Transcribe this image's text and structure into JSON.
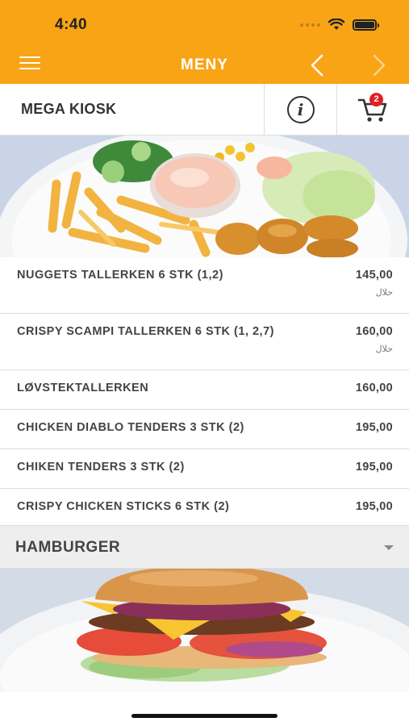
{
  "status_bar": {
    "time": "4:40"
  },
  "nav": {
    "title": "MENY",
    "menu_icon": "hamburger-menu-icon",
    "back_icon": "chevron-left-icon",
    "forward_icon": "chevron-right-icon"
  },
  "kiosk": {
    "name": "MEGA KIOSK",
    "info_icon": "info-icon",
    "cart_icon": "cart-icon",
    "cart_count": "2"
  },
  "menu_items": [
    {
      "name": "NUGGETS TALLERKEN 6 STK (1,2)",
      "price": "145,00",
      "tag": "حلال"
    },
    {
      "name": "CRISPY SCAMPI TALLERKEN 6 STK (1, 2,7)",
      "price": "160,00",
      "tag": "حلال"
    },
    {
      "name": "LØVSTEKTALLERKEN",
      "price": "160,00"
    },
    {
      "name": "CHICKEN DIABLO TENDERS 3 STK (2)",
      "price": "195,00"
    },
    {
      "name": "CHIKEN TENDERS 3 STK (2)",
      "price": "195,00"
    },
    {
      "name": "CRISPY CHICKEN STICKS 6 STK (2)",
      "price": "195,00"
    }
  ],
  "section": {
    "title": "HAMBURGER",
    "caret_icon": "caret-down-icon"
  },
  "colors": {
    "header": "#f8a415",
    "badge": "#e02020"
  }
}
